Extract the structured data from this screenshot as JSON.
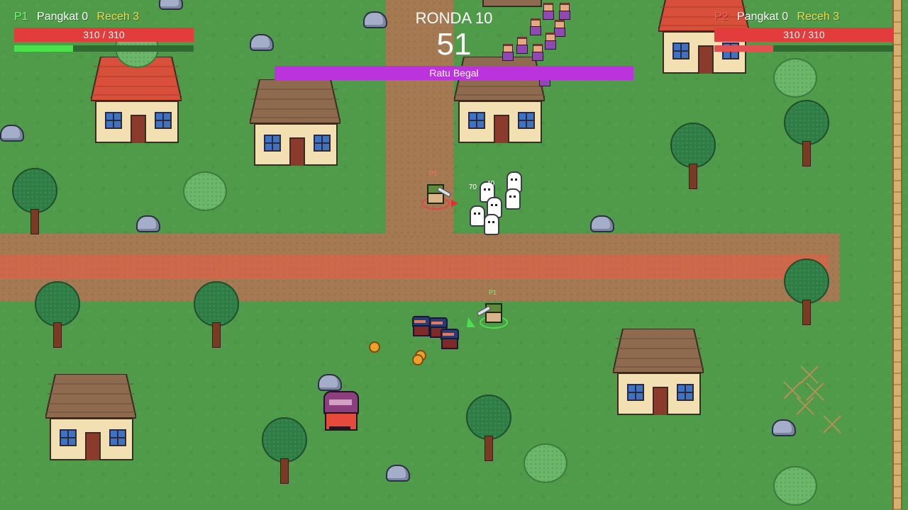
{
  "colors": {
    "p1_tag": "#6bff6b",
    "p2_tag": "#ff5a5a",
    "coins": "#f2d94a",
    "hp_bar": "#e23c3c",
    "boss_bar": "#bb33dd",
    "grass": "#4f9b49",
    "road": "#a57a53"
  },
  "hud": {
    "p1": {
      "tag": "P1",
      "rank_label": "Pangkat 0",
      "coins_label": "Receh 3",
      "hp_text": "310 / 310",
      "xp_fraction": 0.33
    },
    "p2": {
      "tag": "P2",
      "rank_label": "Pangkat 0",
      "coins_label": "Receh 3",
      "hp_text": "310 / 310",
      "xp_fraction": 0.33
    },
    "round_label": "RONDA 10",
    "timer": "51",
    "boss_name": "Ratu Begal"
  },
  "world": {
    "player_tags": {
      "p1": "P1",
      "p2": "P2"
    },
    "damage_numbers": [
      "70",
      "40"
    ],
    "icons": [
      "house-icon",
      "tree-icon",
      "bush-icon",
      "rock-icon",
      "coin-icon",
      "ghost-icon",
      "bandit-icon",
      "boss-icon",
      "player-icon"
    ]
  }
}
